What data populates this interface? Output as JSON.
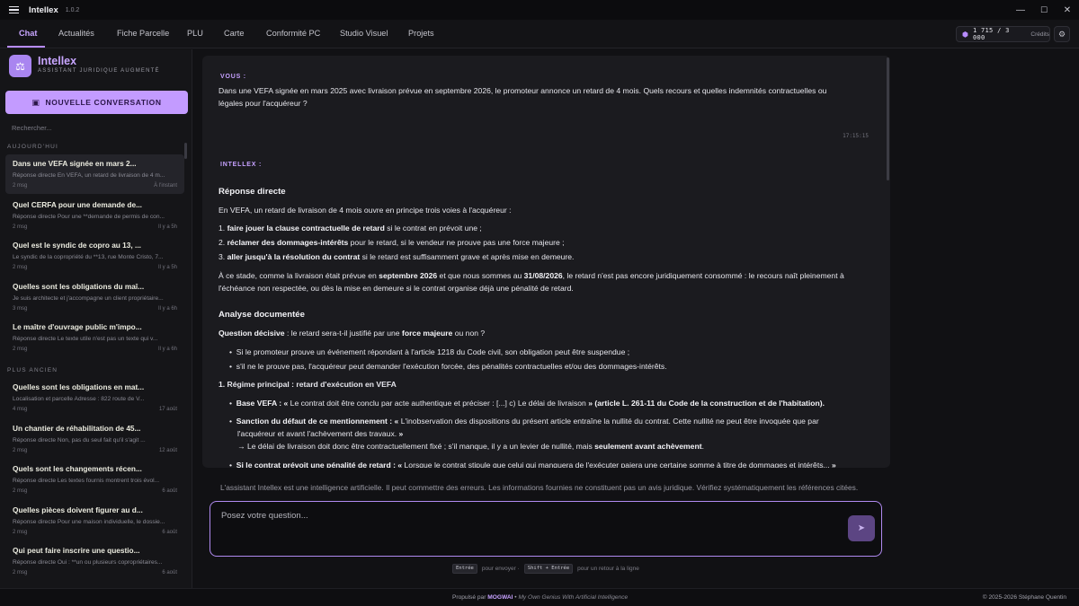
{
  "window": {
    "app_name": "Intellex",
    "version": "1.0.2",
    "controls": [
      "—",
      "☐",
      "✕"
    ]
  },
  "tabs": [
    {
      "label": "Chat"
    },
    {
      "label": "Actualités"
    },
    {
      "label": "Fiche Parcelle"
    },
    {
      "label": "PLU"
    },
    {
      "label": "Carte"
    },
    {
      "label": "Conformité PC"
    },
    {
      "label": "Studio Visuel"
    },
    {
      "label": "Projets"
    }
  ],
  "credits": {
    "count": "1 715 / 3 000",
    "label": "Crédits",
    "icon": "gem-icon"
  },
  "sidebar": {
    "brand_name": "Intellex",
    "brand_subtitle": "ASSISTANT JURIDIQUE AUGMENTÉ",
    "new_conversation": "NOUVELLE CONVERSATION",
    "search_placeholder": "Rechercher...",
    "section_today": "AUJOURD'HUI",
    "section_older": "PLUS ANCIEN",
    "today": [
      {
        "title": "Dans une VEFA signée en mars 2...",
        "preview": "Réponse directe En VEFA, un retard de livraison de 4 m...",
        "count": "2 msg",
        "time": "À l'instant"
      },
      {
        "title": "Quel CERFA pour une demande de...",
        "preview": "Réponse directe Pour une **demande de permis de con...",
        "count": "2 msg",
        "time": "Il y a 5h"
      },
      {
        "title": "Quel est le syndic de copro au 13, ...",
        "preview": "Le syndic de la copropriété du **13, rue Monte Cristo, 7...",
        "count": "2 msg",
        "time": "Il y a 5h"
      },
      {
        "title": "Quelles sont les obligations du maî...",
        "preview": "Je suis architecte et j'accompagne un client propriétaire...",
        "count": "3 msg",
        "time": "Il y a 6h"
      },
      {
        "title": "Le maître d'ouvrage public m'impo...",
        "preview": "Réponse directe Le texte utile n'est pas un texte qui v...",
        "count": "2 msg",
        "time": "Il y a 6h"
      }
    ],
    "older": [
      {
        "title": "Quelles sont les obligations en mat...",
        "preview": "Localisation et parcelle Adresse : 822 route de V...",
        "count": "4 msg",
        "time": "17 août"
      },
      {
        "title": "Un chantier de réhabilitation de 45...",
        "preview": "Réponse directe Non, pas du seul fait qu'il s'agit ...",
        "count": "2 msg",
        "time": "12 août"
      },
      {
        "title": "Quels sont les changements récen...",
        "preview": "Réponse directe Les textes fournis montrent trois évol...",
        "count": "2 msg",
        "time": "6 août"
      },
      {
        "title": "Quelles pièces doivent figurer au d...",
        "preview": "Réponse directe Pour une maison individuelle, le dossie...",
        "count": "2 msg",
        "time": "6 août"
      },
      {
        "title": "Qui peut faire inscrire une questio...",
        "preview": "Réponse directe Oui : **un ou plusieurs copropriétaires...",
        "count": "2 msg",
        "time": "6 août"
      }
    ]
  },
  "chat": {
    "user_label": "VOUS :",
    "user_message_1": "Dans une VEFA signée en mars 2025 avec livraison prévue en septembre 2026, le promoteur annonce un retard de 4 mois. Quels recours et quelles indemnités contractuelles ou",
    "user_message_2": "légales pour l'acquéreur ?",
    "user_time": "17:15:15",
    "ai_label": "INTELLEX :",
    "h_direct": "Réponse directe",
    "p_intro": "En VEFA, un retard de livraison de 4 mois ouvre en principe trois voies à l'acquéreur :",
    "item1_b": "faire jouer la clause contractuelle de retard",
    "item1_t": " si le contrat en prévoit une ;",
    "item2_b": "réclamer des dommages-intérêts",
    "item2_t": " pour le retard, si le vendeur ne prouve pas une force majeure ;",
    "item3_b": "aller jusqu'à la résolution du contrat",
    "item3_t": " si le retard est suffisamment grave et après mise en demeure.",
    "p2_a": "À ce stade, comme la livraison était prévue en ",
    "p2_b1": "septembre 2026",
    "p2_c": " et que nous sommes au ",
    "p2_b2": "31/08/2026",
    "p2_d": ", le retard n'est pas encore juridiquement consommé : le recours naît pleinement à",
    "p2_line2": "l'échéance non respectée, ou dès la mise en demeure si le contrat organise déjà une pénalité de retard.",
    "h_analysis": "Analyse documentée",
    "q_b1": "Question décisive",
    "q_t1": " : le retard sera-t-il justifié par une ",
    "q_b2": "force majeure",
    "q_t2": " ou non ?",
    "b1": "Si le promoteur prouve un événement répondant à l'article 1218 du Code civil, son obligation peut être suspendue ;",
    "b2": "s'il ne le prouve pas, l'acquéreur peut demander l'exécution forcée, des pénalités contractuelles et/ou des dommages-intérêts.",
    "h_regime": "1. Régime principal : retard d'exécution en VEFA",
    "r1_b": "Base VEFA : « ",
    "r1_t": "Le contrat doit être conclu par acte authentique et préciser : [...] c) Le délai de livraison",
    "r1_b2": " » (article L. 261-11 du Code de la construction et de l'habitation).",
    "r2_b": "Sanction du défaut de ce mentionnement : « ",
    "r2_t": "L'inobservation des dispositions du présent article entraîne la nullité du contrat. Cette nullité ne peut être invoquée que par",
    "r2_line2": "l'acquéreur et avant l'achèvement des travaux.",
    "r2_end": " »",
    "r2_arrow_t": "→ Le délai de livraison doit donc être contractuellement fixé ; s'il manque, il y a un levier de nullité, mais ",
    "r2_arrow_b": "seulement avant achèvement",
    "r2_arrow_end": ".",
    "r3_b": "Si le contrat prévoit une pénalité de retard : « ",
    "r3_t": "Lorsque le contrat stipule que celui qui manquera de l'exécuter paiera une certaine somme à titre de dommages et intérêts...",
    "r3_end": " »"
  },
  "disclaimer": "L'assistant Intellex est une intelligence artificielle. Il peut commettre des erreurs. Les informations fournies ne constituent pas un avis juridique. Vérifiez systématiquement les références citées.",
  "composer": {
    "placeholder": "Posez votre question...",
    "hint_key1": "Entrée",
    "hint_text1": "pour envoyer ·",
    "hint_key2": "Shift + Entrée",
    "hint_text2": "pour un retour à la ligne"
  },
  "footer": {
    "powered": "Propulsé par",
    "brand": "MOGWAI",
    "sep": " • ",
    "tagline": "My Own Genius With Artificial Intelligence",
    "copyright": "© 2025-2026 Stéphane Quentin"
  }
}
